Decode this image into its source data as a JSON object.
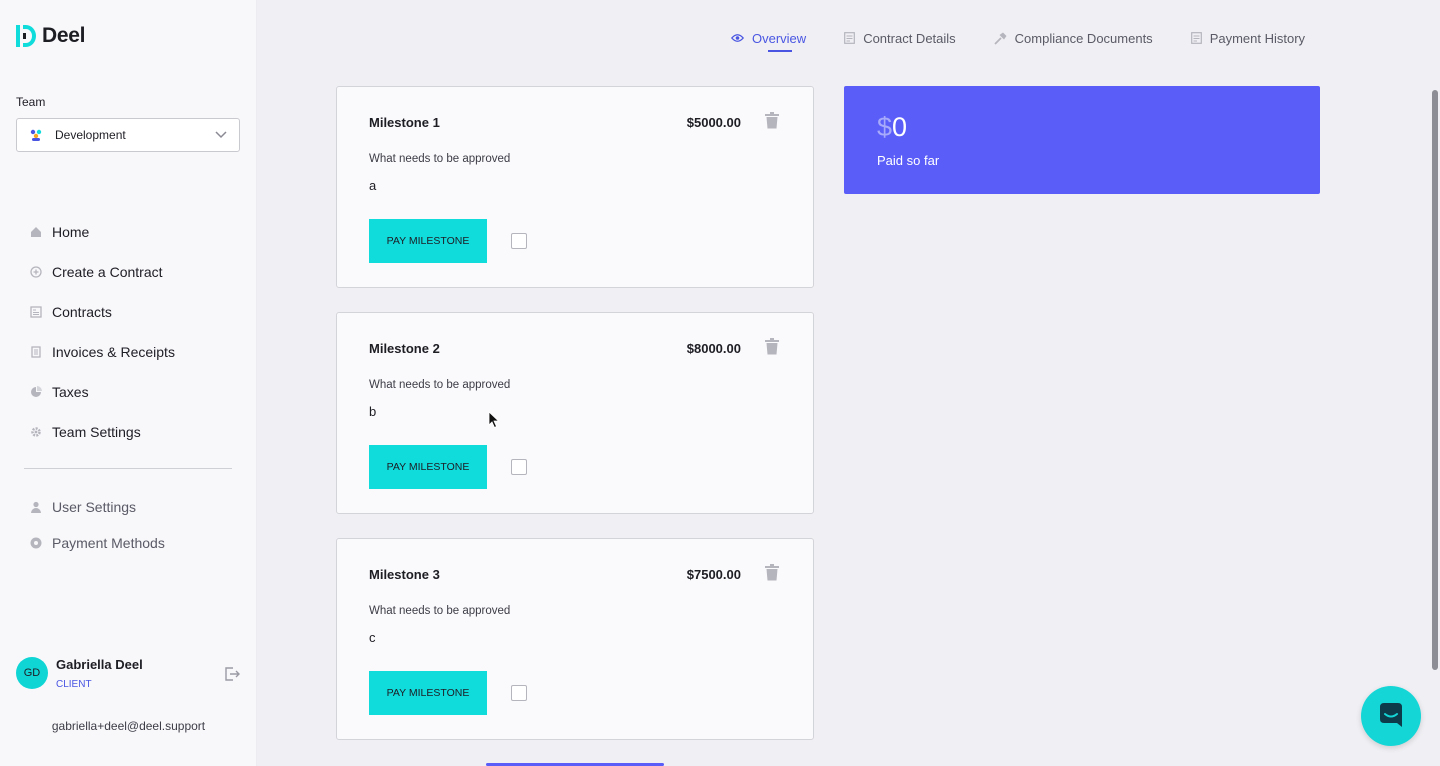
{
  "brand": {
    "name": "Deel",
    "color": "#10dcdc",
    "accent": "#4a56e2"
  },
  "sidebar": {
    "team_label": "Team",
    "team_value": "Development",
    "items": [
      {
        "label": "Home",
        "icon": "home-icon"
      },
      {
        "label": "Create a Contract",
        "icon": "plus-circle-icon"
      },
      {
        "label": "Contracts",
        "icon": "contract-icon"
      },
      {
        "label": "Invoices & Receipts",
        "icon": "invoice-icon"
      },
      {
        "label": "Taxes",
        "icon": "pie-chart-icon"
      },
      {
        "label": "Team Settings",
        "icon": "gear-icon"
      }
    ],
    "secondary_items": [
      {
        "label": "User Settings",
        "icon": "user-icon"
      },
      {
        "label": "Payment Methods",
        "icon": "card-icon"
      }
    ],
    "user": {
      "initials": "GD",
      "name": "Gabriella Deel",
      "role": "CLIENT",
      "email": "gabriella+deel@deel.support"
    }
  },
  "tabs": [
    {
      "label": "Overview",
      "active": true,
      "icon": "eye-icon"
    },
    {
      "label": "Contract Details",
      "active": false,
      "icon": "document-icon"
    },
    {
      "label": "Compliance Documents",
      "active": false,
      "icon": "hammer-icon"
    },
    {
      "label": "Payment History",
      "active": false,
      "icon": "document-icon"
    }
  ],
  "milestones": [
    {
      "title": "Milestone 1",
      "amount": "$5000.00",
      "question": "What needs to be approved",
      "answer": "a",
      "button": "PAY MILESTONE"
    },
    {
      "title": "Milestone 2",
      "amount": "$8000.00",
      "question": "What needs to be approved",
      "answer": "b",
      "button": "PAY MILESTONE"
    },
    {
      "title": "Milestone 3",
      "amount": "$7500.00",
      "question": "What needs to be approved",
      "answer": "c",
      "button": "PAY MILESTONE"
    }
  ],
  "paid": {
    "currency": "$",
    "amount": "0",
    "label": "Paid so far"
  }
}
